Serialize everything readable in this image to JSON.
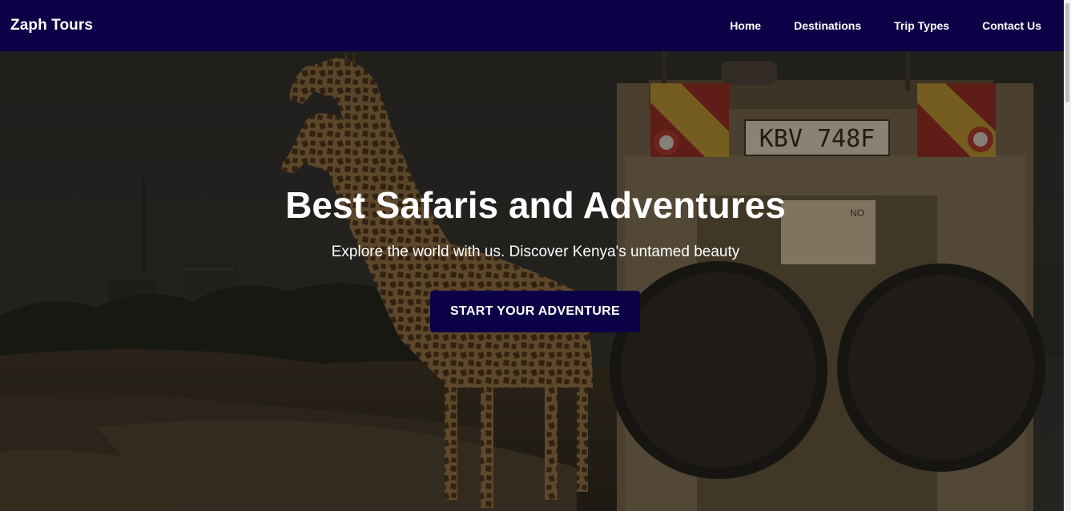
{
  "navbar": {
    "brand": "Zaph Tours",
    "links": [
      "Home",
      "Destinations",
      "Trip Types",
      "Contact Us"
    ]
  },
  "hero": {
    "title": "Best Safaris and Adventures",
    "subtitle": "Explore the world with us. Discover Kenya's untamed beauty",
    "cta_label": "START YOUR ADVENTURE",
    "image": {
      "license_plate": "KBV 748F",
      "sign_text": "NO"
    }
  },
  "colors": {
    "navbar_bg": "#0c0146",
    "button_bg": "#0c0146",
    "text": "#ffffff"
  }
}
